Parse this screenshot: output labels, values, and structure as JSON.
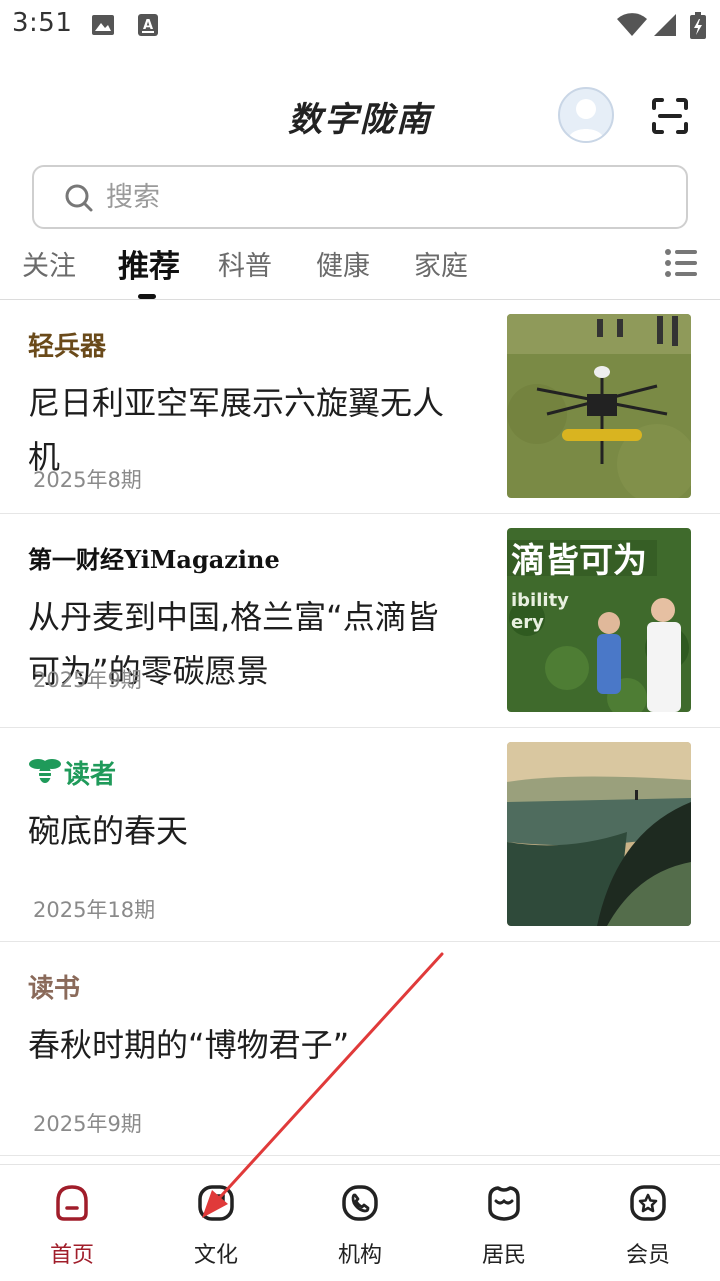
{
  "status_bar": {
    "time": "3:51"
  },
  "header": {
    "title": "数字陇南"
  },
  "search": {
    "placeholder": "搜索"
  },
  "tabs": [
    {
      "label": "关注",
      "active": false
    },
    {
      "label": "推荐",
      "active": true
    },
    {
      "label": "科普",
      "active": false
    },
    {
      "label": "健康",
      "active": false
    },
    {
      "label": "家庭",
      "active": false
    }
  ],
  "feed": [
    {
      "source": "轻兵器",
      "source_color": "#6a4a1a",
      "title": "尼日利亚空军展示六旋翼无人机",
      "issue": "2025年8期"
    },
    {
      "source": "第一财经YiMagazine",
      "source_color": "#111111",
      "title": "从丹麦到中国,格兰富“点滴皆可为”的零碳愿景",
      "issue": "2025年9期"
    },
    {
      "source": "读者",
      "source_color": "#1f9a5a",
      "title": "碗底的春天",
      "issue": "2025年18期"
    },
    {
      "source": "读书",
      "source_color": "#8a6a5a",
      "title": "春秋时期的“博物君子”",
      "issue": "2025年9期"
    }
  ],
  "bottom_nav": [
    {
      "label": "首页",
      "active": true
    },
    {
      "label": "文化",
      "active": false
    },
    {
      "label": "机构",
      "active": false
    },
    {
      "label": "居民",
      "active": false
    },
    {
      "label": "会员",
      "active": false
    }
  ],
  "colors": {
    "accent": "#a01d2a",
    "annotation_arrow": "#e03a3a"
  }
}
